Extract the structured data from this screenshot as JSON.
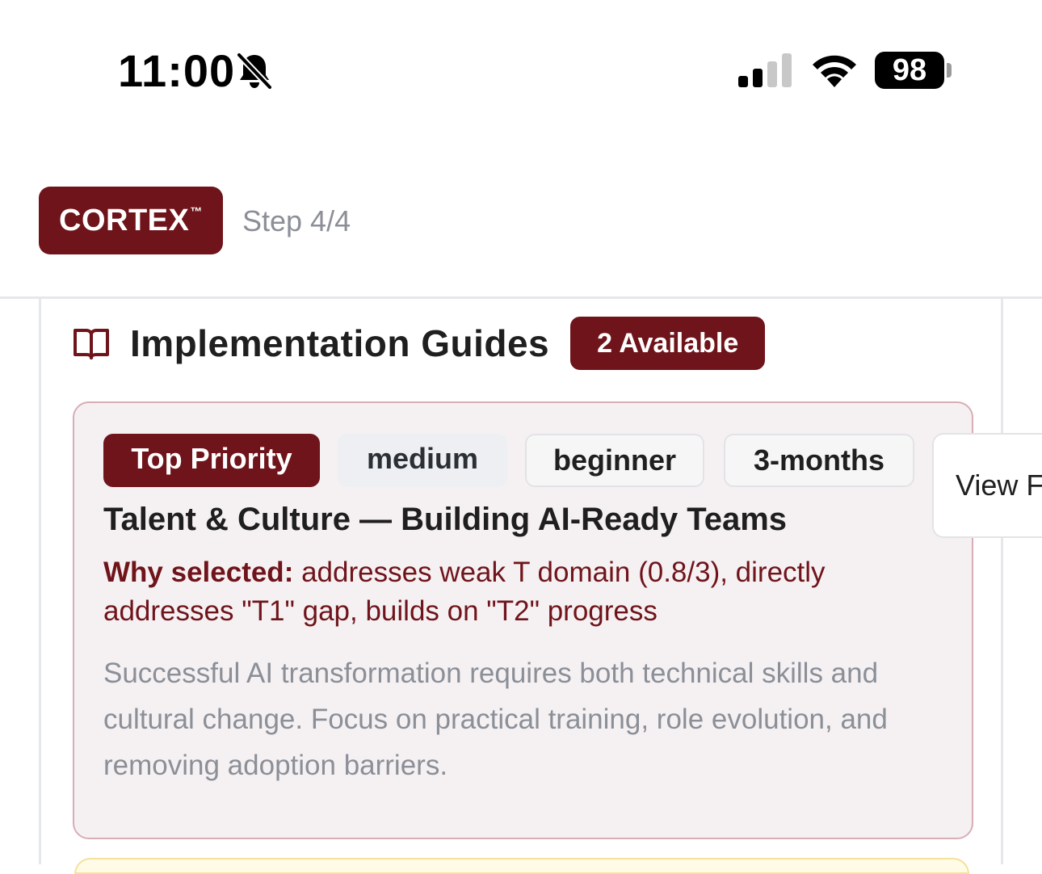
{
  "status_bar": {
    "time": "11:00",
    "battery": "98",
    "icons": [
      "bell-slash-icon",
      "cellular-signal-icon",
      "wifi-icon",
      "battery-icon"
    ]
  },
  "header": {
    "brand": "CORTEX",
    "brand_mark": "™",
    "step": "Step 4/4"
  },
  "section": {
    "icon": "book-open-icon",
    "title": "Implementation Guides",
    "count_badge": "2 Available"
  },
  "guide": {
    "tags": {
      "priority": "Top Priority",
      "effort": "medium",
      "level": "beginner",
      "duration": "3-months"
    },
    "title": "Talent & Culture — Building AI-Ready Teams",
    "why_label": "Why selected:",
    "why_text": " addresses weak T domain (0.8/3), directly addresses \"T1\" gap, builds on \"T2\" progress",
    "description": "Successful AI transformation requires both technical skills and cultural change. Focus on practical training, role evolution, and removing adoption barriers."
  },
  "view_button": {
    "label": "View F"
  },
  "colors": {
    "brand": "#6f141a",
    "card_bg": "#f5f1f3",
    "card_border": "#d7aeb5",
    "muted_text": "#8b8f97",
    "next_card_bg": "#fffbe6"
  }
}
